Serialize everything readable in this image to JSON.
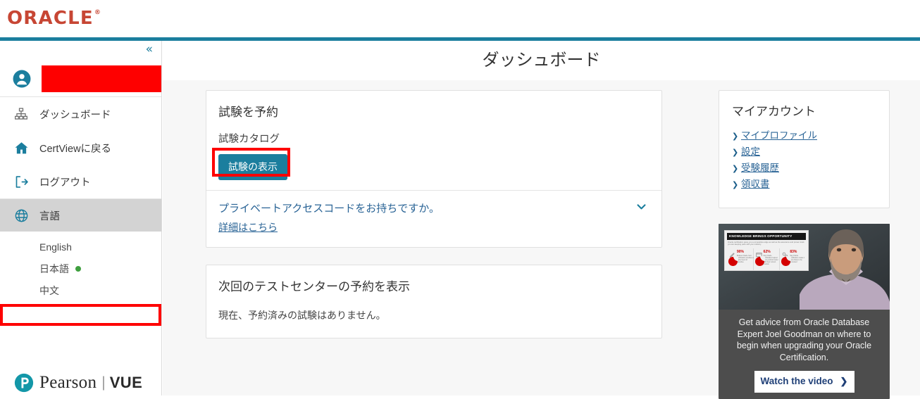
{
  "brand": {
    "oracle_logo": "ORACLE",
    "oracle_reg": "®",
    "accent_teal": "#1b7e9e",
    "oracle_red": "#C74634",
    "highlight_red": "#fe0000"
  },
  "sidebar": {
    "collapse_icon": "chevron-double-left-icon",
    "collapse_glyph": "«",
    "user": {
      "avatar_icon": "user-avatar-icon",
      "name_redacted": ""
    },
    "nav": [
      {
        "icon": "sitemap-icon",
        "label": "ダッシュボード"
      },
      {
        "icon": "home-icon",
        "label": "CertViewに戻る"
      },
      {
        "icon": "logout-icon",
        "label": "ログアウト"
      }
    ],
    "language": {
      "icon": "globe-icon",
      "label": "言語",
      "options": [
        {
          "label": "English",
          "active": false
        },
        {
          "label": "日本語",
          "active": true
        },
        {
          "label": "中文",
          "active": false
        }
      ]
    },
    "footer_logo": {
      "mark": "pearson-p-icon",
      "word": "Pearson",
      "separator": "|",
      "vue": "VUE"
    }
  },
  "main": {
    "title": "ダッシュボード",
    "schedule_card": {
      "heading": "試験を予約",
      "subtitle": "試験カタログ",
      "button_label": "試験の表示",
      "private_access_question": "プライベートアクセスコードをお持ちですか。",
      "private_access_link": "詳細はこちら",
      "expand_icon": "chevron-down-icon"
    },
    "appointments_card": {
      "heading": "次回のテストセンターの予約を表示",
      "body": "現在、予約済みの試験はありません。"
    }
  },
  "account_panel": {
    "heading": "マイアカウント",
    "links": [
      {
        "label": "マイプロファイル"
      },
      {
        "label": "設定"
      },
      {
        "label": "受験履歴"
      },
      {
        "label": "領収書"
      }
    ]
  },
  "promo": {
    "slide_title": "KNOWLEDGE BRINGS OPPORTUNITY",
    "slide_subtitle": "Oracle certification gives you a competitive edge as well as the assurance and proven track you are keeping pace with your industry.",
    "stats": [
      {
        "value": "90%",
        "caption": "Believe Oracle Cert. certification provides a higher level of expertise"
      },
      {
        "value": "62%",
        "caption": "Say Oracle certification helped them perform better with their current position"
      },
      {
        "value": "83%",
        "caption": "Say Oracle certification made it more likely to be promoted"
      }
    ],
    "text": "Get advice from Oracle Database Expert Joel Goodman on where to begin when upgrading your Oracle Certification.",
    "button_label": "Watch the video",
    "button_chevron": "❯"
  }
}
